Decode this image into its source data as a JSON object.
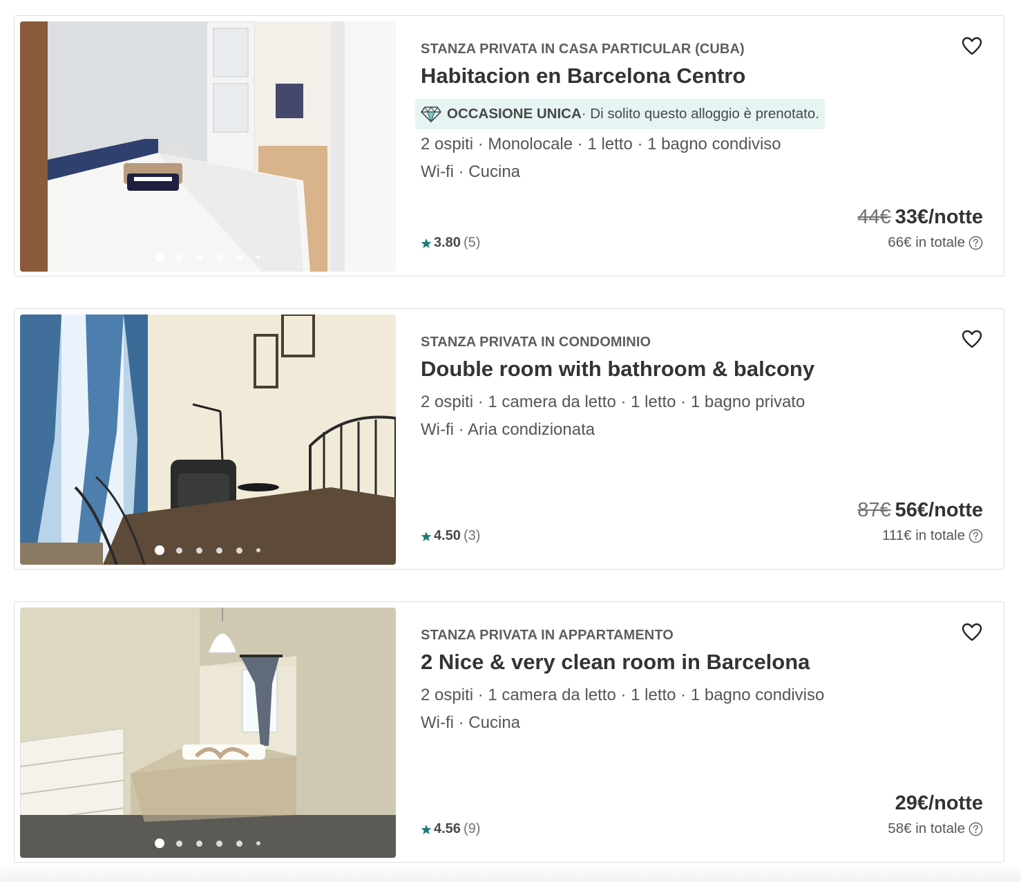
{
  "listings": [
    {
      "type": "STANZA PRIVATA IN CASA PARTICULAR (CUBA)",
      "title": "Habitacion en Barcelona Centro",
      "badge": {
        "label": "OCCASIONE UNICA",
        "text": " · Di solito questo alloggio è prenotato."
      },
      "details": "2 ospiti · Monolocale · 1 letto · 1 bagno condiviso",
      "amenities": "Wi-fi · Cucina",
      "rating": "3.80",
      "reviews": "(5)",
      "old_price": "44€",
      "price": "33€/notte",
      "total": "66€ in totale"
    },
    {
      "type": "STANZA PRIVATA IN CONDOMINIO",
      "title": "Double room with bathroom & balcony",
      "details": "2 ospiti · 1 camera da letto · 1 letto · 1 bagno privato",
      "amenities": "Wi-fi · Aria condizionata",
      "rating": "4.50",
      "reviews": "(3)",
      "old_price": "87€",
      "price": "56€/notte",
      "total": "111€ in totale"
    },
    {
      "type": "STANZA PRIVATA IN APPARTAMENTO",
      "title": "2 Nice & very clean room in Barcelona",
      "details": "2 ospiti · 1 camera da letto · 1 letto · 1 bagno condiviso",
      "amenities": "Wi-fi · Cucina",
      "rating": "4.56",
      "reviews": "(9)",
      "price": "29€/notte",
      "total": "58€ in totale"
    }
  ],
  "icons": {
    "favorite": "heart-icon",
    "rating": "star-icon",
    "badge": "diamond-icon",
    "help": "question-circle-icon"
  },
  "colors": {
    "star": "#1f7a7a",
    "badge_bg": "#e6f4f3"
  }
}
